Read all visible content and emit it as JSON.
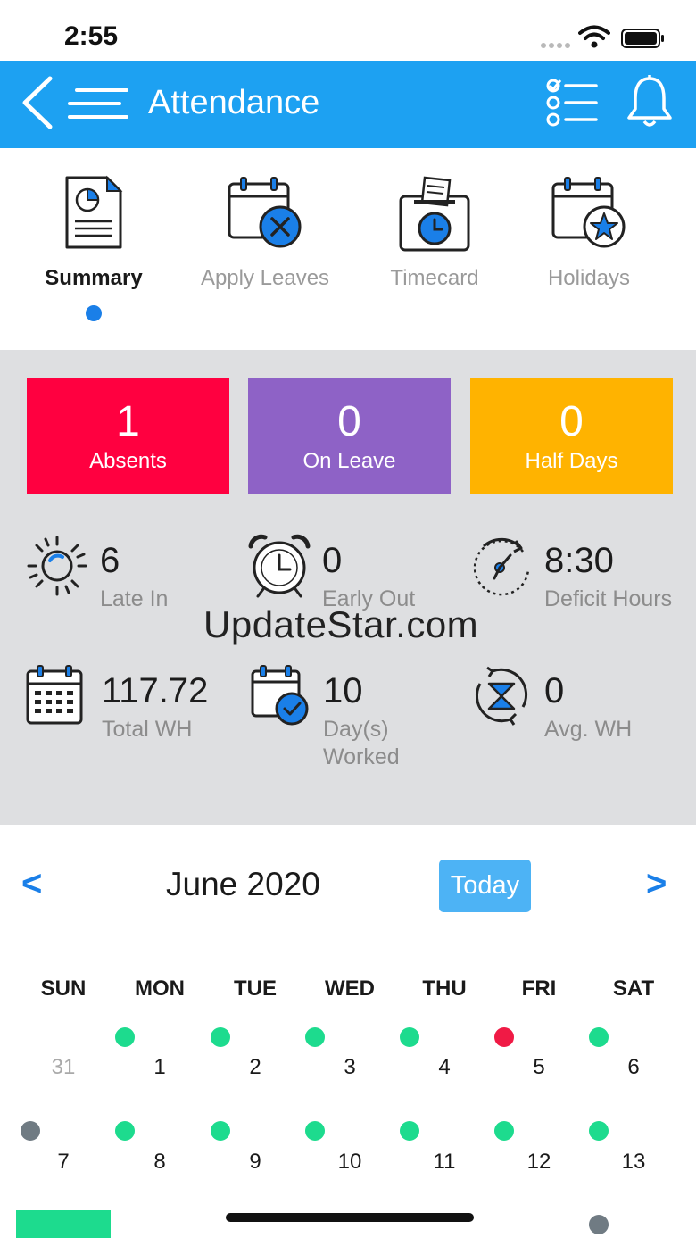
{
  "status": {
    "time": "2:55"
  },
  "header": {
    "title": "Attendance"
  },
  "tabs": [
    {
      "label": "Summary",
      "icon": "summary-report-icon",
      "active": true
    },
    {
      "label": "Apply Leaves",
      "icon": "calendar-cancel-icon",
      "active": false
    },
    {
      "label": "Timecard",
      "icon": "timecard-icon",
      "active": false
    },
    {
      "label": "Holidays",
      "icon": "calendar-star-icon",
      "active": false
    }
  ],
  "stat_cards": [
    {
      "value": "1",
      "label": "Absents",
      "color": "#ff0040"
    },
    {
      "value": "0",
      "label": "On Leave",
      "color": "#8e62c6"
    },
    {
      "value": "0",
      "label": "Half Days",
      "color": "#ffb300"
    }
  ],
  "metrics": [
    {
      "value": "6",
      "label": "Late In",
      "icon": "sun-icon"
    },
    {
      "value": "0",
      "label": "Early Out",
      "icon": "alarm-clock-icon"
    },
    {
      "value": "8:30",
      "label": "Deficit Hours",
      "icon": "deficit-clock-icon"
    },
    {
      "value": "117.72",
      "label": "Total WH",
      "icon": "calendar-grid-icon"
    },
    {
      "value": "10",
      "label": "Day(s) Worked",
      "icon": "calendar-check-icon"
    },
    {
      "value": "0",
      "label": "Avg. WH",
      "icon": "hourglass-cycle-icon"
    }
  ],
  "watermark": "UpdateStar.com",
  "calendar": {
    "month_label": "June 2020",
    "today_label": "Today",
    "prev_label": "<",
    "next_label": ">",
    "weekdays": [
      "SUN",
      "MON",
      "TUE",
      "WED",
      "THU",
      "FRI",
      "SAT"
    ],
    "weeks": [
      [
        {
          "day": "31",
          "muted": true,
          "status": ""
        },
        {
          "day": "1",
          "status": "present"
        },
        {
          "day": "2",
          "status": "present"
        },
        {
          "day": "3",
          "status": "present"
        },
        {
          "day": "4",
          "status": "present"
        },
        {
          "day": "5",
          "status": "absent"
        },
        {
          "day": "6",
          "status": "present"
        }
      ],
      [
        {
          "day": "7",
          "status": "weekend"
        },
        {
          "day": "8",
          "status": "present"
        },
        {
          "day": "9",
          "status": "present"
        },
        {
          "day": "10",
          "status": "present"
        },
        {
          "day": "11",
          "status": "present"
        },
        {
          "day": "12",
          "status": "present"
        },
        {
          "day": "13",
          "status": "present"
        }
      ],
      [
        {
          "day": "",
          "status": "weekend"
        },
        {
          "day": "",
          "status": ""
        },
        {
          "day": "",
          "status": ""
        },
        {
          "day": "",
          "status": ""
        },
        {
          "day": "",
          "status": ""
        },
        {
          "day": "",
          "status": ""
        },
        {
          "day": "",
          "status": "weekend"
        }
      ]
    ],
    "status_colors": {
      "present": "#1ddb8e",
      "absent": "#f01a45",
      "weekend": "#707b83"
    }
  },
  "colors": {
    "header": "#1da1f2",
    "accent": "#1a7fe8",
    "summary_bg": "#dedfe1"
  }
}
